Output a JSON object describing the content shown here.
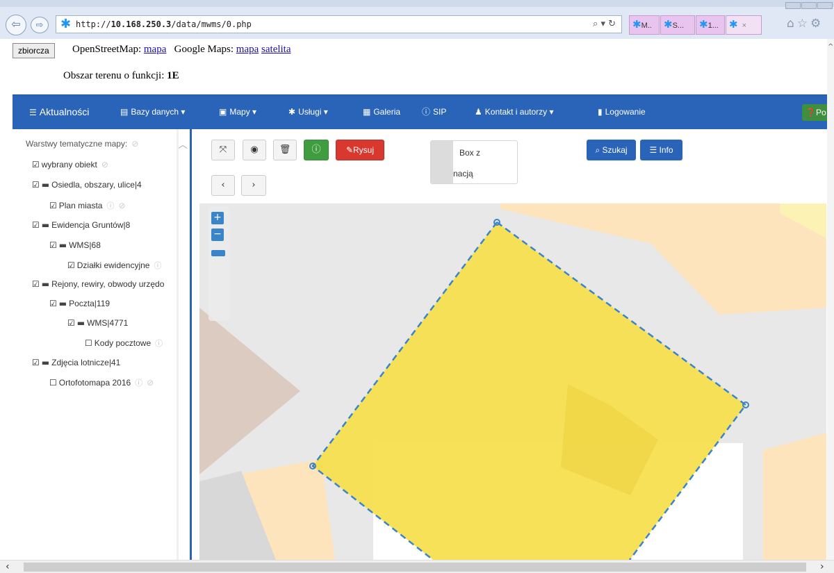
{
  "browser": {
    "url_prefix": "http://",
    "url_host": "10.168.250.3",
    "url_path": "/data/mwms/0.php",
    "addr_tools": "⌕ ▾ ↻",
    "tabs": [
      {
        "label": "M..",
        "close": ""
      },
      {
        "label": "S...",
        "close": ""
      },
      {
        "label": "1...",
        "close": ""
      },
      {
        "label": "",
        "close": "×"
      }
    ],
    "accent": "#2196f3"
  },
  "top": {
    "zbiorcza_label": "zbiorcza",
    "osm_text": "OpenStreetMap:",
    "osm_link": "mapa",
    "gm_text": "Google Maps:",
    "gm_link_map": "mapa",
    "gm_link_sat": "satelita",
    "terrain_label": "Obszar terenu o funkcji:",
    "terrain_value": "1E"
  },
  "navbar": {
    "color": "#2a64b8",
    "items": [
      {
        "label": "Aktualności",
        "icon": "menu-icon"
      },
      {
        "label": "Bazy danych",
        "icon": "list-icon"
      },
      {
        "label": "Mapy",
        "icon": "picture-icon"
      },
      {
        "label": "Usługi",
        "icon": "asterisk-icon"
      },
      {
        "label": "Galeria",
        "icon": "grid-icon"
      },
      {
        "label": "SIP",
        "icon": "info-icon"
      },
      {
        "label": "Kontakt i autorzy",
        "icon": "user-icon"
      },
      {
        "label": "Logowanie",
        "icon": "lock-icon"
      }
    ],
    "help_label": "Po"
  },
  "sidebar": {
    "header": "Warstwy tematyczne mapy:",
    "items": [
      {
        "label": "wybrany obiekt",
        "checked": true,
        "folder": false
      },
      {
        "label": "Osiedla, obszary, ulice|4",
        "checked": true,
        "folder": true
      },
      {
        "label": "Plan miasta",
        "checked": true,
        "folder": false
      },
      {
        "label": "Ewidencja Gruntów|8",
        "checked": true,
        "folder": true
      },
      {
        "label": "WMS|68",
        "checked": true,
        "folder": true
      },
      {
        "label": "Działki ewidencyjne",
        "checked": true,
        "folder": false
      },
      {
        "label": "Rejony, rewiry, obwody urzędo",
        "checked": true,
        "folder": true
      },
      {
        "label": "Poczta|119",
        "checked": true,
        "folder": true
      },
      {
        "label": "WMS|4771",
        "checked": true,
        "folder": true
      },
      {
        "label": "Kody pocztowe",
        "checked": false,
        "folder": false
      },
      {
        "label": "Zdjęcia lotnicze|41",
        "checked": true,
        "folder": true
      },
      {
        "label": "Ortofotomapa 2016",
        "checked": false,
        "folder": false
      }
    ]
  },
  "toolbar": {
    "rysuj_label": "Rysuj",
    "box_line1": "Box z",
    "box_line2": "nacją",
    "szukaj_label": "Szukaj",
    "info_label": "Info",
    "info_color": "#3f9d3f",
    "rysuj_color": "#d9382f"
  },
  "map": {
    "selection_fill": "#f5de4a",
    "selection_stroke": "#3a84c9",
    "zoom_in": "+",
    "zoom_out": "−"
  }
}
